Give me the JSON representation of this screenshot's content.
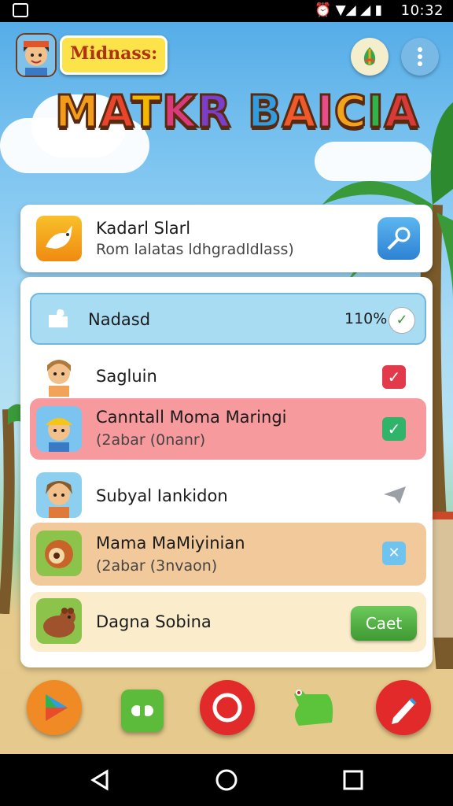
{
  "status_bar": {
    "time": "10:32"
  },
  "header": {
    "title": "Midnass:",
    "logo": "MATKR BAICIA",
    "logo_colors": [
      "#f39c1a",
      "#e8452c",
      "#f5b800",
      "#d93a7a",
      "#7a3ec9",
      "#2f9de0",
      "#f05a2a",
      "#e84c8a",
      "#f3a21c",
      "#2fb44d",
      "#d83a3a",
      "#9b4dca"
    ]
  },
  "top_card": {
    "title": "Kadarl Slarl",
    "subtitle": "Rom lalatas ldhgradldlass)"
  },
  "list": {
    "header_row": {
      "label": "Nadasd",
      "value": "110%"
    },
    "rows": [
      {
        "title": "Sagluin",
        "subtitle": "",
        "state": "red",
        "icon": "girl-avatar"
      },
      {
        "title": "Canntall Moma Maringi",
        "subtitle": "(2abar (0nanr)",
        "state": "green",
        "icon": "boy-hardhat-avatar"
      },
      {
        "title": "Subyal Iankidon",
        "subtitle": "",
        "state": "grey",
        "icon": "girl-kid-avatar"
      },
      {
        "title": "Mama MaMiyinian",
        "subtitle": "(2abar (3nvaon)",
        "state": "blue",
        "icon": "monkey-avatar"
      },
      {
        "title": "Dagna Sobina",
        "subtitle": "",
        "state": "button",
        "icon": "bear-avatar",
        "button_label": "Caet"
      }
    ]
  },
  "colors": {
    "red_row": "#f79a9e",
    "orange_row": "#f2c99a",
    "cream_row": "#fbeccb",
    "blue_row": "#a8dcf2",
    "green_btn": "#4aa83c"
  },
  "bottom_bar": {
    "icons": [
      "play-store-icon",
      "puzzle-icon",
      "record-icon",
      "dino-icon",
      "pencil-icon"
    ]
  }
}
